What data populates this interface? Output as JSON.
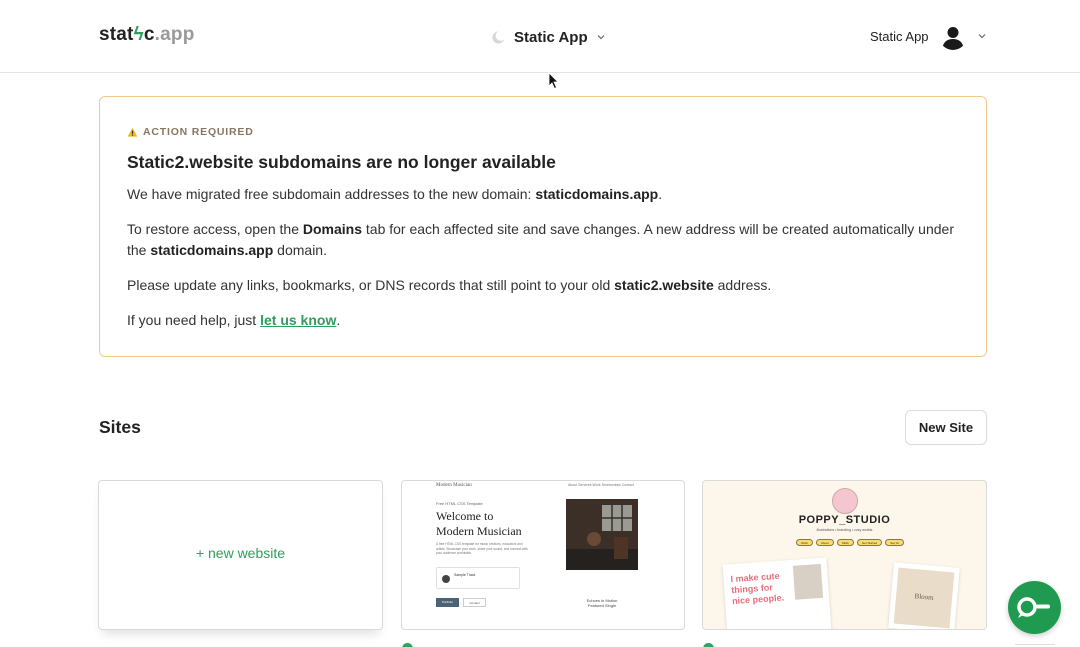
{
  "header": {
    "logo": {
      "part1": "stat",
      "bolt": "ϟ",
      "part2": "c",
      "suffix": ".app"
    },
    "app_switcher": {
      "label": "Static App",
      "icon": "moon-icon"
    },
    "user_menu": {
      "name": "Static App",
      "icon": "avatar-icon"
    }
  },
  "alert": {
    "tag": "ACTION REQUIRED",
    "title": "Static2.website subdomains are no longer available",
    "p1": {
      "text": "We have migrated free subdomain addresses to the new domain: ",
      "bold": "staticdomains.app",
      "end": "."
    },
    "p2": {
      "t1": "To restore access, open the ",
      "b1": "Domains",
      "t2": " tab for each affected site and save changes. A new address will be created automatically under the ",
      "b2": "staticdomains.app",
      "t3": " domain."
    },
    "p3": {
      "t1": "Please update any links, bookmarks, or DNS records that still point to your old ",
      "b1": "static2.website",
      "t2": " address."
    },
    "p4": {
      "t1": "If you need help, just ",
      "link": "let us know",
      "t2": "."
    }
  },
  "sites": {
    "title": "Sites",
    "new_site_label": "New Site",
    "new_website_label": "+ new website",
    "music_card": {
      "brand": "Modern Musician",
      "nav": "About    Services    Work    Testimonials    Contact",
      "kicker": "Free HTML CSS Template",
      "headline1": "Welcome to",
      "headline2": "Modern Musician",
      "desc": "A free HTML CSS template for music creators, educators and artists. Showcase your work, share your sound, and connect with your audience worldwide.",
      "track": "Sample Track",
      "btn1": "Portfolio",
      "btn2": "Contact",
      "caption1": "Echoes in Motion",
      "caption2": "Featured Single"
    },
    "poppy_card": {
      "title": "POPPY_STUDIO",
      "subtitle": "illustrations • branding • cozy worlds",
      "pills": [
        "Work",
        "About",
        "Skills",
        "Get Started",
        "Say Hi"
      ],
      "headline": "I make cute things for nice people.",
      "sign": "Bloom"
    }
  },
  "colors": {
    "accent": "#2e9e5b",
    "alert_border": "#f0c98a",
    "chat": "#219a51"
  }
}
